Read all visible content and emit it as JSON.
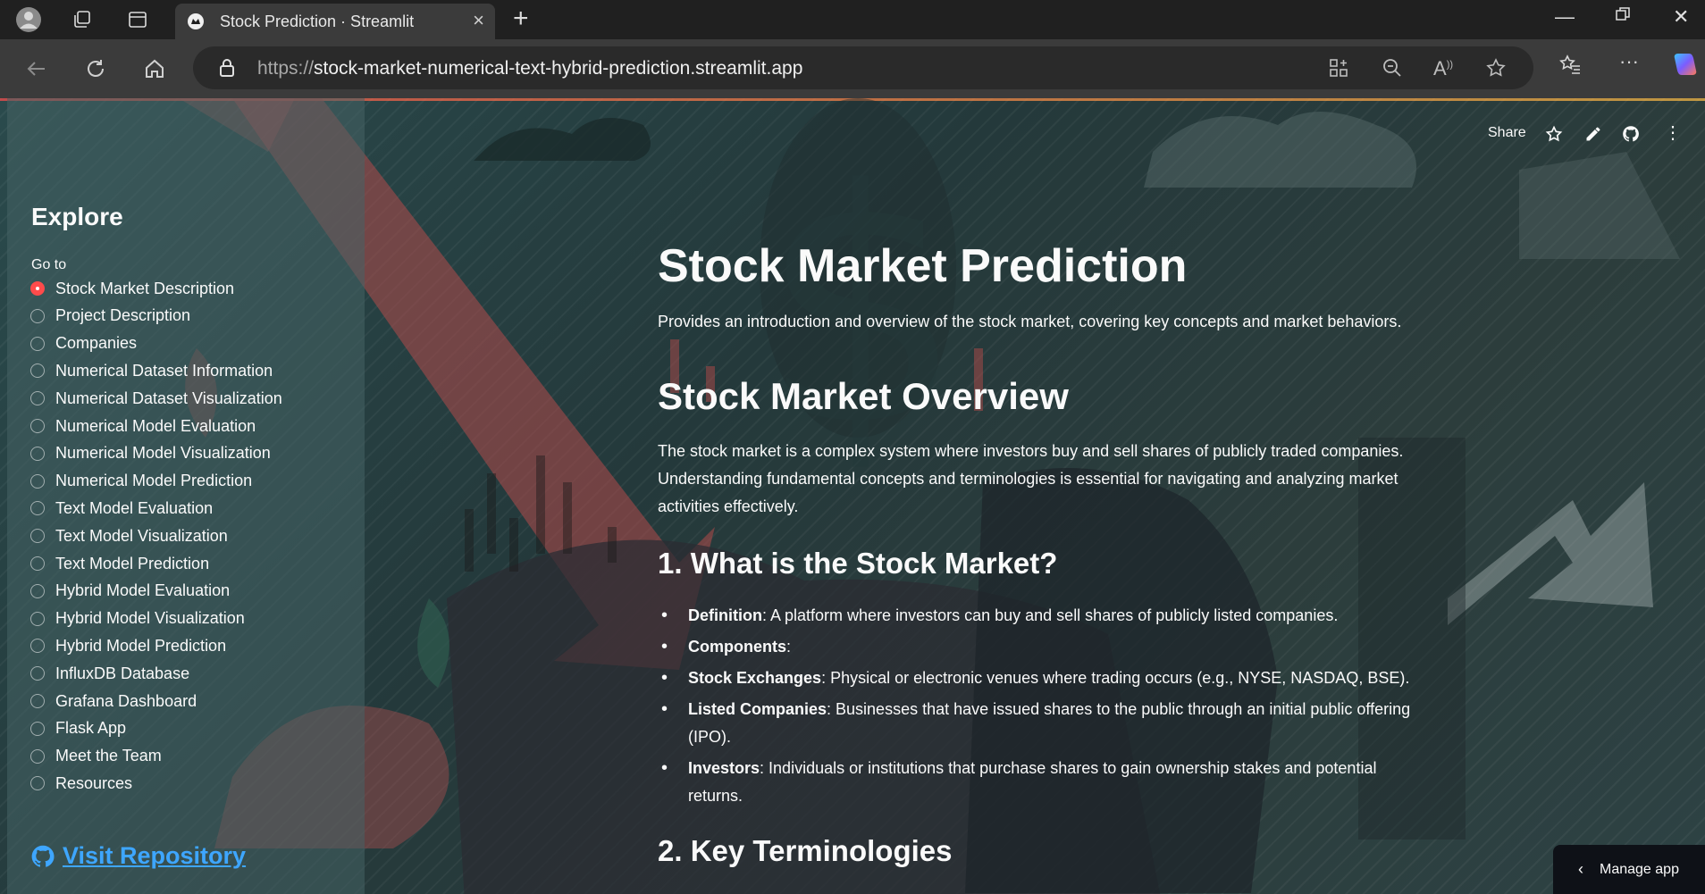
{
  "browser": {
    "tab_title": "Stock Prediction · Streamlit",
    "url_protocol": "https://",
    "url_rest": "stock-market-numerical-text-hybrid-prediction.streamlit.app"
  },
  "app_header": {
    "share_label": "Share"
  },
  "sidebar": {
    "title": "Explore",
    "goto_label": "Go to",
    "items": [
      {
        "label": "Stock Market Description",
        "selected": true
      },
      {
        "label": "Project Description"
      },
      {
        "label": "Companies"
      },
      {
        "label": "Numerical Dataset Information"
      },
      {
        "label": "Numerical Dataset Visualization"
      },
      {
        "label": "Numerical Model Evaluation"
      },
      {
        "label": "Numerical Model Visualization"
      },
      {
        "label": "Numerical Model Prediction"
      },
      {
        "label": "Text Model Evaluation"
      },
      {
        "label": "Text Model Visualization"
      },
      {
        "label": "Text Model Prediction"
      },
      {
        "label": "Hybrid Model Evaluation"
      },
      {
        "label": "Hybrid Model Visualization"
      },
      {
        "label": "Hybrid Model Prediction"
      },
      {
        "label": "InfluxDB Database"
      },
      {
        "label": "Grafana Dashboard"
      },
      {
        "label": "Flask App"
      },
      {
        "label": "Meet the Team"
      },
      {
        "label": "Resources"
      }
    ],
    "repo_link": "Visit Repository"
  },
  "main": {
    "title": "Stock Market Prediction",
    "intro": "Provides an introduction and overview of the stock market, covering key concepts and market behaviors.",
    "overview_heading": "Stock Market Overview",
    "overview_text": "The stock market is a complex system where investors buy and sell shares of publicly traded companies. Understanding fundamental concepts and terminologies is essential for navigating and analyzing market activities effectively.",
    "section1_heading": "1. What is the Stock Market?",
    "bullets": [
      {
        "term": "Definition",
        "text": ": A platform where investors can buy and sell shares of publicly listed companies."
      },
      {
        "term": "Components",
        "text": ":"
      },
      {
        "term": "Stock Exchanges",
        "text": ": Physical or electronic venues where trading occurs (e.g., NYSE, NASDAQ, BSE)."
      },
      {
        "term": "Listed Companies",
        "text": ": Businesses that have issued shares to the public through an initial public offering (IPO)."
      },
      {
        "term": "Investors",
        "text": ": Individuals or institutions that purchase shares to gain ownership stakes and potential returns."
      }
    ],
    "section2_heading": "2. Key Terminologies"
  },
  "manage_app": "Manage app",
  "colors": {
    "accent": "#ff4b4b",
    "link": "#3ea6ff",
    "sidebar_bg": "#466264",
    "text": "#fafafa"
  }
}
